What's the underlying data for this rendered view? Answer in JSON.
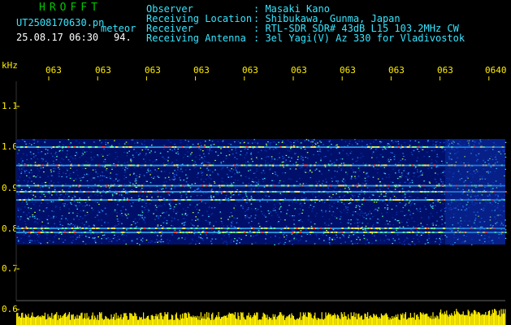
{
  "header": {
    "brand": "HROFFT",
    "filename": "UT2508170630.pn",
    "datetime": "25.08.17 06:30",
    "event_label": "meteor",
    "event_count": "94.",
    "info_labels": [
      "Observer",
      "Receiving Location",
      "Receiver",
      "Receiving Antenna"
    ],
    "info_values": [
      ": Masaki Kano",
      ": Shibukawa, Gunma, Japan",
      ": RTL-SDR SDR# 43dB L15 103.2MHz CW",
      ": 3el Yagi(V) Az 330 for Vladivostok"
    ]
  },
  "axis": {
    "y_unit": "kHz",
    "y_ticks": [
      "1.1",
      "1.0",
      "0.9",
      "0.8",
      "0.7",
      "0.6"
    ],
    "x_ticks": [
      "063",
      "063",
      "063",
      "063",
      "063",
      "063",
      "063",
      "063",
      "063",
      "0640"
    ]
  },
  "colors": {
    "background": "#000000",
    "axis_text": "#ffee00",
    "brand": "#00c800",
    "info_text": "#36e6ff",
    "signal_band": "#00106a",
    "bottom_bar": "#ffee00"
  },
  "spectrogram": {
    "freq_range_khz": [
      0.6,
      1.12
    ],
    "noise_band_khz": [
      0.76,
      1.02
    ],
    "persistent_lines_khz": [
      1.0,
      0.955,
      0.905,
      0.89,
      0.87,
      0.8,
      0.79
    ]
  }
}
